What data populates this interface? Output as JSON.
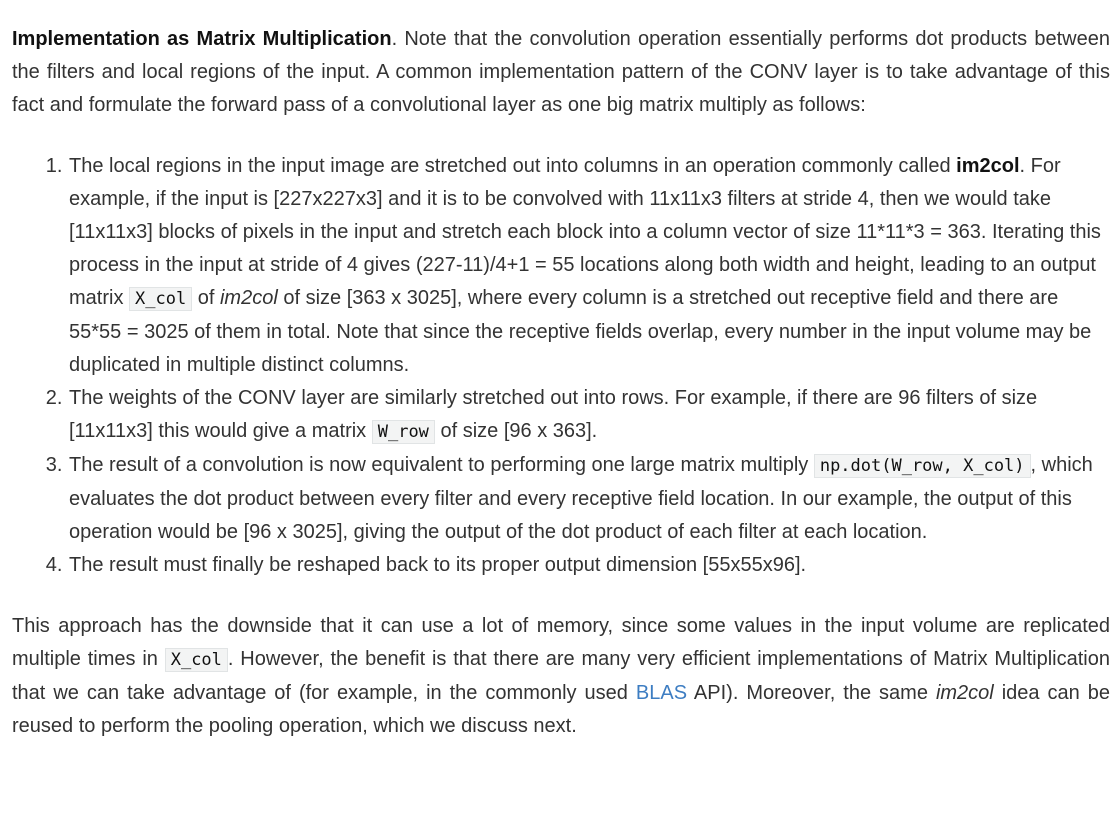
{
  "intro": {
    "heading": "Implementation as Matrix Multiplication",
    "text": ". Note that the convolution operation essentially performs dot products between the filters and local regions of the input. A common implementation pattern of the CONV layer is to take advantage of this fact and formulate the forward pass of a convolutional layer as one big matrix multiply as follows:"
  },
  "steps": [
    {
      "t1": "The local regions in the input image are stretched out into columns in an operation commonly called ",
      "bold": "im2col",
      "t2": ". For example, if the input is [227x227x3] and it is to be convolved with 11x11x3 filters at stride 4, then we would take [11x11x3] blocks of pixels in the input and stretch each block into a column vector of size 11*11*3 = 363. Iterating this process in the input at stride of 4 gives (227-11)/4+1 = 55 locations along both width and height, leading to an output matrix ",
      "code": "X_col",
      "t3": " of ",
      "em": "im2col",
      "t4": " of size [363 x 3025], where every column is a stretched out receptive field and there are 55*55 = 3025 of them in total. Note that since the receptive fields overlap, every number in the input volume may be duplicated in multiple distinct columns."
    },
    {
      "t1": "The weights of the CONV layer are similarly stretched out into rows. For example, if there are 96 filters of size [11x11x3] this would give a matrix ",
      "code": "W_row",
      "t2": " of size [96 x 363]."
    },
    {
      "t1": "The result of a convolution is now equivalent to performing one large matrix multiply ",
      "code": "np.dot(W_row, X_col)",
      "t2": ", which evaluates the dot product between every filter and every receptive field location. In our example, the output of this operation would be [96 x 3025], giving the output of the dot product of each filter at each location."
    },
    {
      "t1": "The result must finally be reshaped back to its proper output dimension [55x55x96]."
    }
  ],
  "outro": {
    "t1": "This approach has the downside that it can use a lot of memory, since some values in the input volume are replicated multiple times in ",
    "code": "X_col",
    "t2": ". However, the benefit is that there are many very efficient implementations of Matrix Multiplication that we can take advantage of (for example, in the commonly used ",
    "link": "BLAS",
    "t3": " API). Moreover, the same ",
    "em": "im2col",
    "t4": " idea can be reused to perform the pooling operation, which we discuss next."
  },
  "colors": {
    "text": "#333333",
    "link": "#3d7dc2",
    "code_bg": "#f3f4f4"
  }
}
